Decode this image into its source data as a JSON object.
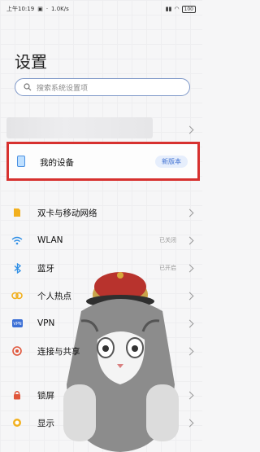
{
  "status_bar": {
    "time": "上午10:19",
    "speed": "1.0K/s",
    "battery": "100"
  },
  "page": {
    "title": "设置"
  },
  "search": {
    "placeholder": "搜索系统设置项"
  },
  "device": {
    "label": "我的设备",
    "badge": "新版本"
  },
  "menu": [
    {
      "label": "双卡与移动网络",
      "value": "",
      "icon": "sim-card-icon",
      "color": "#f2b01e"
    },
    {
      "label": "WLAN",
      "value": "已关闭",
      "icon": "wifi-icon",
      "color": "#2f8fe6"
    },
    {
      "label": "蓝牙",
      "value": "已开启",
      "icon": "bluetooth-icon",
      "color": "#2f8fe6"
    },
    {
      "label": "个人热点",
      "value": "",
      "icon": "hotspot-icon",
      "color": "#f2b01e"
    },
    {
      "label": "VPN",
      "value": "",
      "icon": "vpn-icon",
      "color": "#3b6fd6"
    },
    {
      "label": "连接与共享",
      "value": "",
      "icon": "share-icon",
      "color": "#e0563b"
    },
    {
      "label": "锁屏",
      "value": "",
      "icon": "lock-icon",
      "color": "#e0563b"
    },
    {
      "label": "显示",
      "value": "",
      "icon": "display-icon",
      "color": "#f2b01e"
    }
  ],
  "colors": {
    "highlight": "#d7312f",
    "accent": "#3d6fd1"
  }
}
